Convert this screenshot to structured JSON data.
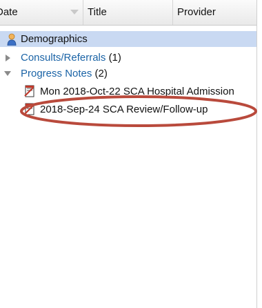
{
  "header": {
    "date": "Date",
    "title": "Title",
    "provider": "Provider"
  },
  "tree": {
    "demographics": "Demographics",
    "consults": {
      "label": "Consults/Referrals",
      "count": "(1)"
    },
    "progress": {
      "label": "Progress Notes",
      "count": "(2)"
    },
    "notes": [
      "Mon 2018-Oct-22 SCA Hospital Admission",
      "2018-Sep-24 SCA Review/Follow-up"
    ]
  },
  "colors": {
    "selected_bg": "#c9d9f2",
    "link": "#1a63a6",
    "annotation": "#c0392b"
  }
}
